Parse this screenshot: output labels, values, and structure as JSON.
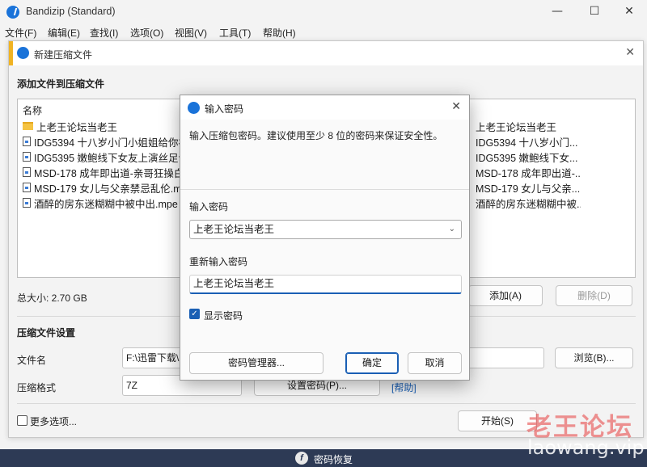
{
  "app": {
    "title": "Bandizip (Standard)",
    "minimize": "—",
    "maximize": "☐",
    "close": "✕"
  },
  "menu": [
    "文件(F)",
    "编辑(E)",
    "查找(I)",
    "选项(O)",
    "视图(V)",
    "工具(T)",
    "帮助(H)"
  ],
  "compress_dialog": {
    "title": "新建压缩文件",
    "close": "✕",
    "add_files_section": "添加文件到压缩文件",
    "list_header": "名称",
    "files": [
      {
        "name": "上老王论坛当老王",
        "type": "folder"
      },
      {
        "name": "IDG5394 十八岁小门小姐姐给你初",
        "type": "file"
      },
      {
        "name": "IDG5395 嫩鲍线下女友上演丝足诱",
        "type": "file"
      },
      {
        "name": "MSD-178 成年即出道-亲哥狂操白",
        "type": "file"
      },
      {
        "name": "MSD-179 女儿与父亲禁忌乱伦.mp",
        "type": "file"
      },
      {
        "name": "酒醉的房东迷糊糊中被中出.mpe",
        "type": "file"
      }
    ],
    "files_right": [
      "上老王论坛当老王",
      "IDG5394 十八岁小门...",
      "IDG5395 嫩鲍线下女...",
      "MSD-178 成年即出道-...",
      "MSD-179 女儿与父亲...",
      "酒醉的房东迷糊糊中被..."
    ],
    "total_size": "总大小: 2.70 GB",
    "add_button": "添加(A)",
    "delete_button": "删除(D)",
    "settings_section": "压缩文件设置",
    "filename_label": "文件名",
    "filename_value": "F:\\迅雷下载\\",
    "browse_button": "浏览(B)...",
    "format_label": "压缩格式",
    "format_value": "7Z",
    "set_password_button": "设置密码(P)...",
    "help_link": "[帮助]",
    "more_options": "更多选项...",
    "start_button": "开始(S)"
  },
  "password_dialog": {
    "title": "输入密码",
    "close": "✕",
    "description": "输入压缩包密码。建议使用至少 8 位的密码来保证安全性。",
    "password_label": "输入密码",
    "password_value": "上老王论坛当老王",
    "reenter_label": "重新输入密码",
    "reenter_value": "上老王论坛当老王",
    "show_password_label": "显示密码",
    "show_password_checked": true,
    "password_manager_button": "密码管理器...",
    "ok_button": "确定",
    "cancel_button": "取消"
  },
  "bottom_bar": {
    "recover_label": "密码恢复"
  },
  "watermark": {
    "cn": "老王论坛",
    "en": "laowang.vip"
  },
  "colors": {
    "accent": "#1a5fb4",
    "bottom_bar": "#2d3a55",
    "title_accent": "#f0b323"
  }
}
